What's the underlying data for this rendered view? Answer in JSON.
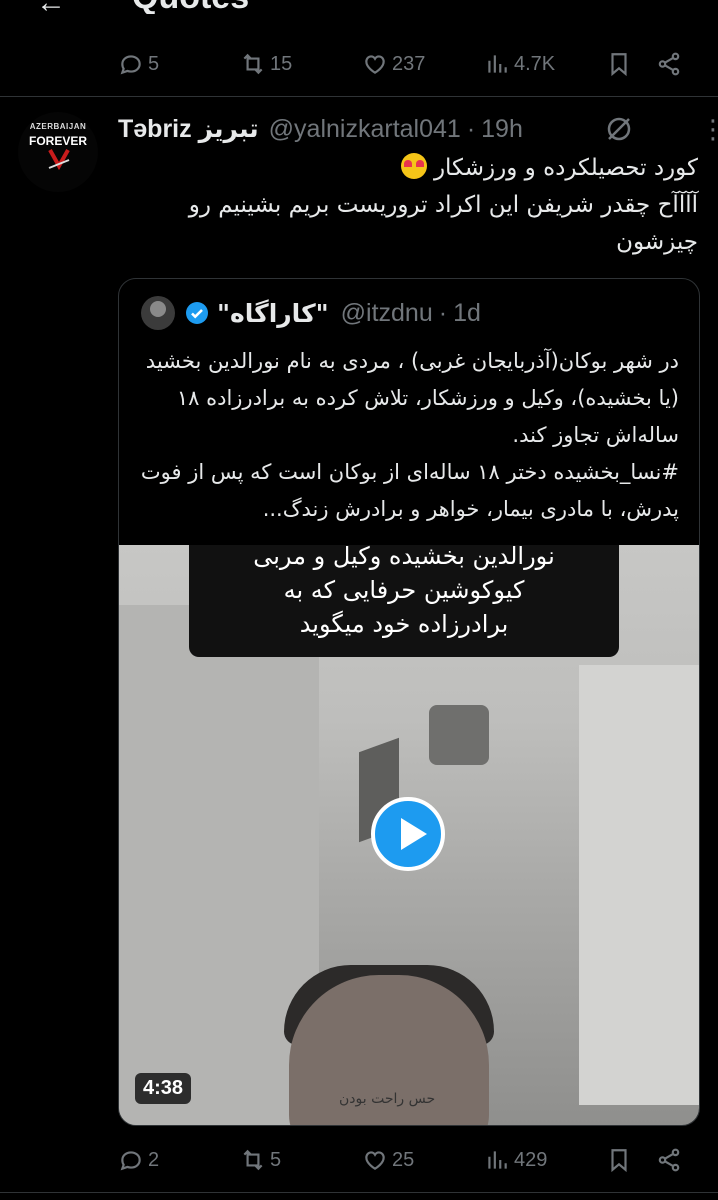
{
  "header": {
    "title": "Quotes",
    "back_icon": "arrow-left-icon"
  },
  "prev_actions": {
    "replies": "5",
    "reposts": "15",
    "likes": "237",
    "views": "4.7K"
  },
  "tweet": {
    "avatar_line1": "AZERBAIJAN",
    "avatar_line2": "FOREVER",
    "name": "Təbriz تبریز",
    "handle": "@yalnizkartal041",
    "time": "19h",
    "text_line1": "کورد تحصیلکرده و ورزشکار",
    "text_line2": "آآآآح چقدر شریفن این اکراد تروریست بریم بشینیم رو چیزشون",
    "actions": {
      "replies": "2",
      "reposts": "5",
      "likes": "25",
      "views": "429"
    }
  },
  "quote": {
    "name": "\"کاراگاه\"",
    "handle": "@itzdnu",
    "time": "1d",
    "text": "در شهر بوکان(آذربایجان غربی) ، مردی به نام نورالدین بخشید (یا بخشیده)، وکیل و ورزشکار، تلاش کرده به برادرزاده ۱۸ ساله‌اش تجاوز کند.",
    "text2": "#نسا_بخشیده دختر ۱۸ ساله‌ای از بوکان است که پس از فوت پدرش، با مادری بیمار، خواهر و برادرش زندگ...",
    "video": {
      "caption_line1": "نورالدین بخشیده وکیل و مربی",
      "caption_line2": "کیوکوشین حرفایی که به",
      "caption_line3": "برادرزاده خود میگوید",
      "duration": "4:38",
      "overlay_text": "حس راحت بودن"
    }
  }
}
